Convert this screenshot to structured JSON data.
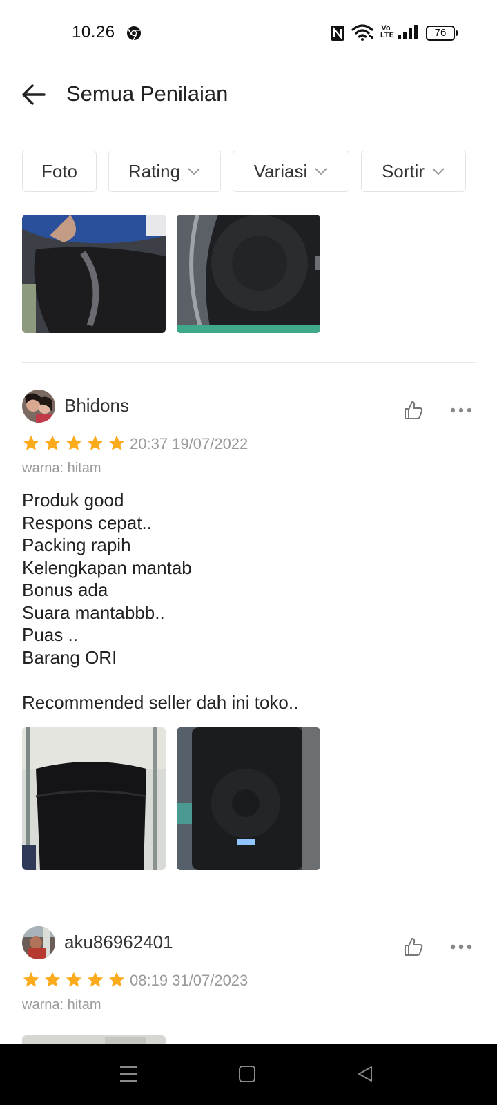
{
  "status_bar": {
    "time": "10.26",
    "battery": "76",
    "volte": "Vo LTE",
    "icons": [
      "chrome-icon",
      "nfc-icon",
      "wifi-icon",
      "volte-icon",
      "signal-icon",
      "battery-icon"
    ]
  },
  "header": {
    "title": "Semua Penilaian",
    "back_icon": "arrow-left-icon"
  },
  "filters": [
    {
      "label": "Foto",
      "dropdown": false
    },
    {
      "label": "Rating",
      "dropdown": true
    },
    {
      "label": "Variasi",
      "dropdown": true
    },
    {
      "label": "Sortir",
      "dropdown": true
    }
  ],
  "reviews": [
    {
      "username": "Bhidons",
      "rating": 5,
      "time": "20:37 19/07/2022",
      "variant": "warna: hitam",
      "text": "Produk good\nRespons cepat..\nPacking rapih\nKelengkapan mantab\nBonus ada\nSuara mantabbb..\nPuas ..\nBarang ORI\n\nRecommended seller dah ini toko.."
    },
    {
      "username": "aku86962401",
      "rating": 5,
      "time": "08:19 31/07/2023",
      "variant": "warna: hitam"
    }
  ],
  "colors": {
    "star": "#fbab1b",
    "meta_text": "#9a9a9a",
    "divider": "#e8e8e8",
    "nav_bar": "#000000"
  }
}
